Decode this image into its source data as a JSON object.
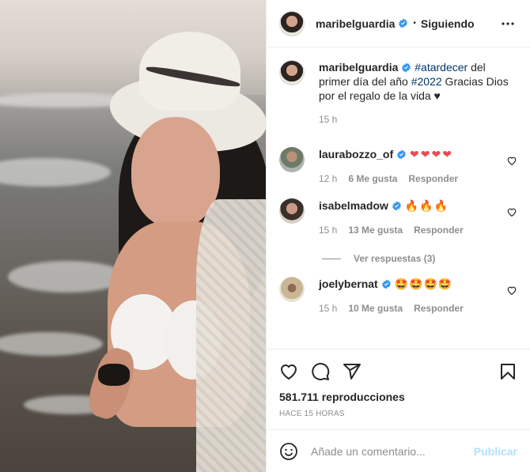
{
  "post": {
    "author": "maribelguardia",
    "follow_state": "Siguiendo",
    "separator": "•"
  },
  "caption": {
    "author": "maribelguardia",
    "tag1": "#atardecer",
    "text1": " del primer día del año ",
    "tag2": "#2022",
    "text2": " Gracias Dios por el regalo de la vida ♥",
    "time": "15 h"
  },
  "comments": [
    {
      "user": "laurabozzo_of",
      "text": "❤❤❤❤",
      "time": "12 h",
      "likes": "6 Me gusta",
      "reply": "Responder"
    },
    {
      "user": "isabelmadow",
      "text": "🔥🔥🔥",
      "time": "15 h",
      "likes": "13 Me gusta",
      "reply": "Responder"
    },
    {
      "user": "joelybernat",
      "text": "🤩🤩🤩🤩",
      "time": "15 h",
      "likes": "10 Me gusta",
      "reply": "Responder"
    }
  ],
  "view_replies": "Ver respuestas (3)",
  "stats": {
    "views": "581.711 reproducciones",
    "posted": "HACE 15 HORAS"
  },
  "composer": {
    "placeholder": "Añade un comentario...",
    "post_label": "Publicar"
  },
  "colors": {
    "verified": "#3897f0",
    "link": "#00376b",
    "muted": "#8e8e8e",
    "post_disabled": "#b2dffc"
  }
}
